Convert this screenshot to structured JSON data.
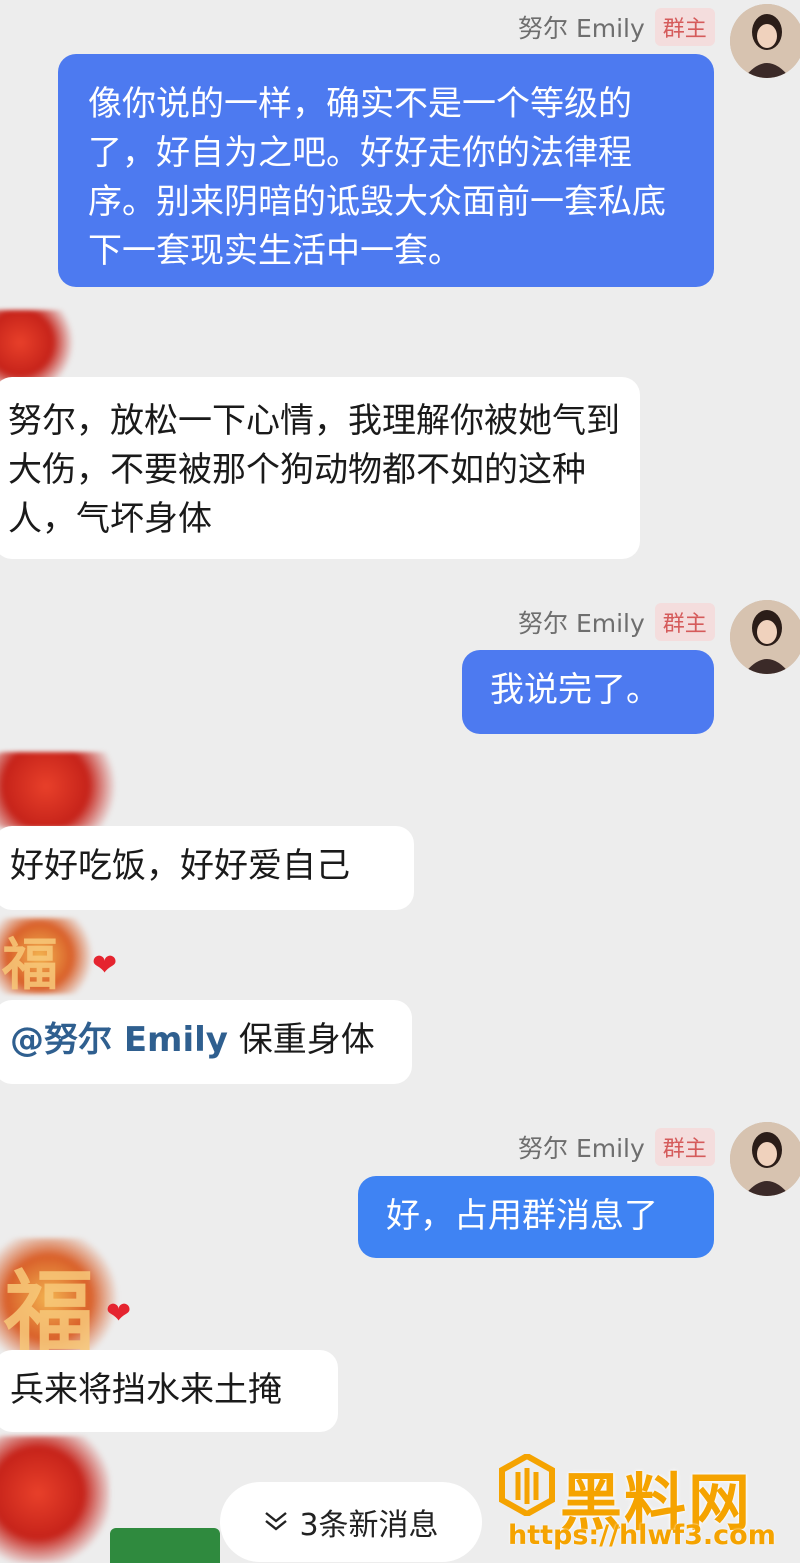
{
  "chat": {
    "sender_name": "努尔 Emily",
    "owner_badge": "群主",
    "messages": [
      {
        "from": "self",
        "text": "像你说的一样，确实不是一个等级的了，好自为之吧。好好走你的法律程序。别来阴暗的诋毁大众面前一套私底下一套现实生活中一套。"
      },
      {
        "from": "other",
        "text": "努尔，放松一下心情，我理解你被她气到大伤，不要被那个狗动物都不如的这种人，气坏身体"
      },
      {
        "from": "self",
        "text": "我说完了。"
      },
      {
        "from": "other",
        "text": "好好吃饭，好好爱自己"
      },
      {
        "from": "other",
        "mention": "@努尔 Emily",
        "text": " 保重身体"
      },
      {
        "from": "self",
        "text": "好，占用群消息了"
      },
      {
        "from": "other",
        "text": "兵来将挡水来土掩"
      }
    ],
    "new_messages_label": "3条新消息"
  },
  "decor": {
    "sticker_glyph": "福",
    "heart": "❤"
  },
  "watermark": {
    "title": "黑料网",
    "url": "https://hlwf3.com"
  },
  "colors": {
    "self_bubble": "#4d7af0",
    "background": "#ededed",
    "badge_text": "#d55b5b",
    "watermark": "#f5a300"
  }
}
